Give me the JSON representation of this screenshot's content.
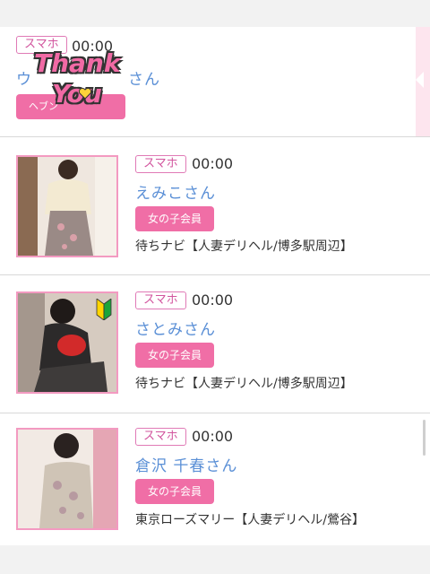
{
  "items": [
    {
      "device": "スマホ",
      "time": "00:00",
      "name_prefix": "ウ",
      "name_suffix": "さん",
      "button": "ヘブン",
      "stamp_line1": "Thank",
      "stamp_line2": "You"
    },
    {
      "device": "スマホ",
      "time": "00:00",
      "name": "えみこさん",
      "member_label": "女の子会員",
      "shop": "待ちナビ【人妻デリヘル/博多駅周辺】"
    },
    {
      "device": "スマホ",
      "time": "00:00",
      "name": "さとみさん",
      "member_label": "女の子会員",
      "shop": "待ちナビ【人妻デリヘル/博多駅周辺】",
      "badge_icon": "beginner-mark-icon"
    },
    {
      "device": "スマホ",
      "time": "00:00",
      "name": "倉沢 千春さん",
      "member_label": "女の子会員",
      "shop": "東京ローズマリー【人妻デリヘル/鶯谷】"
    }
  ],
  "colors": {
    "accent_pink": "#f06ea6",
    "name_blue": "#5a8fd6"
  }
}
